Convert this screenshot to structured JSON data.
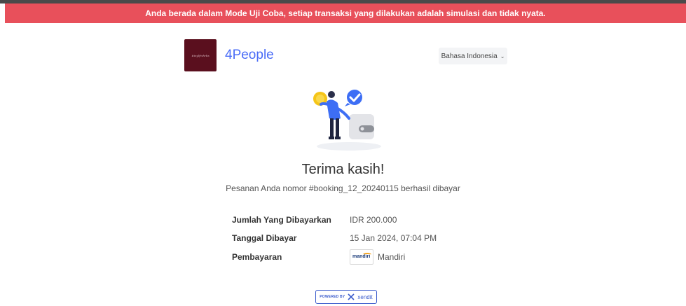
{
  "banner": {
    "text": "Anda berada dalam Mode Uji Coba, setiap transaksi yang dilakukan adalah simulasi dan tidak nyata."
  },
  "colors": {
    "banner_bg": "#e8505b",
    "merchant_name": "#4a6cf7",
    "logo_bg": "#5a0f1e",
    "xendit_blue": "#3b5ccc"
  },
  "header": {
    "merchant_logo_text": "#inylfrshrbs",
    "merchant_name": "4People",
    "language": {
      "selected": "Bahasa Indonesia",
      "icon": "chevron-down-icon"
    }
  },
  "main": {
    "illustration": "success-illustration",
    "title": "Terima kasih!",
    "message": "Pesanan Anda nomor #booking_12_20240115 berhasil dibayar",
    "details": {
      "amount_label": "Jumlah Yang Dibayarkan",
      "amount_value": "IDR 200.000",
      "date_label": "Tanggal Dibayar",
      "date_value": "15 Jan 2024, 07:04 PM",
      "payment_label": "Pembayaran",
      "payment_method": "Mandiri",
      "payment_logo_text": "mandiri"
    }
  },
  "footer": {
    "powered_by": "POWERED BY",
    "provider": "xendit"
  }
}
